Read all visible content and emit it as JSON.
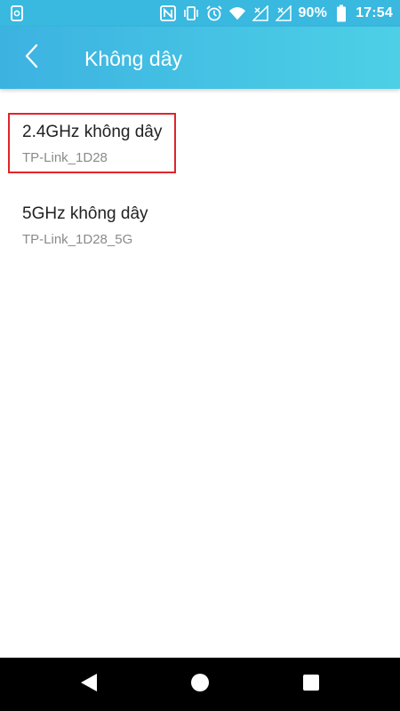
{
  "status_bar": {
    "battery_percent": "90%",
    "time": "17:54",
    "icons": [
      "screenshot-icon",
      "nfc-icon",
      "vibrate-icon",
      "alarm-icon",
      "wifi-icon",
      "signal-icon",
      "signal-icon",
      "battery-icon"
    ]
  },
  "app_bar": {
    "title": "Không dây",
    "back_icon": "chevron-left-icon"
  },
  "list": {
    "items": [
      {
        "title": "2.4GHz không dây",
        "subtitle": "TP-Link_1D28"
      },
      {
        "title": "5GHz không dây",
        "subtitle": "TP-Link_1D28_5G"
      }
    ]
  },
  "nav_bar": {
    "icons": [
      "back-triangle-icon",
      "home-circle-icon",
      "recents-square-icon"
    ]
  },
  "colors": {
    "status_bar": "#39b8e0",
    "app_bar_start": "#3cb2e1",
    "app_bar_end": "#4dd0e6",
    "highlight": "#e0242a"
  }
}
